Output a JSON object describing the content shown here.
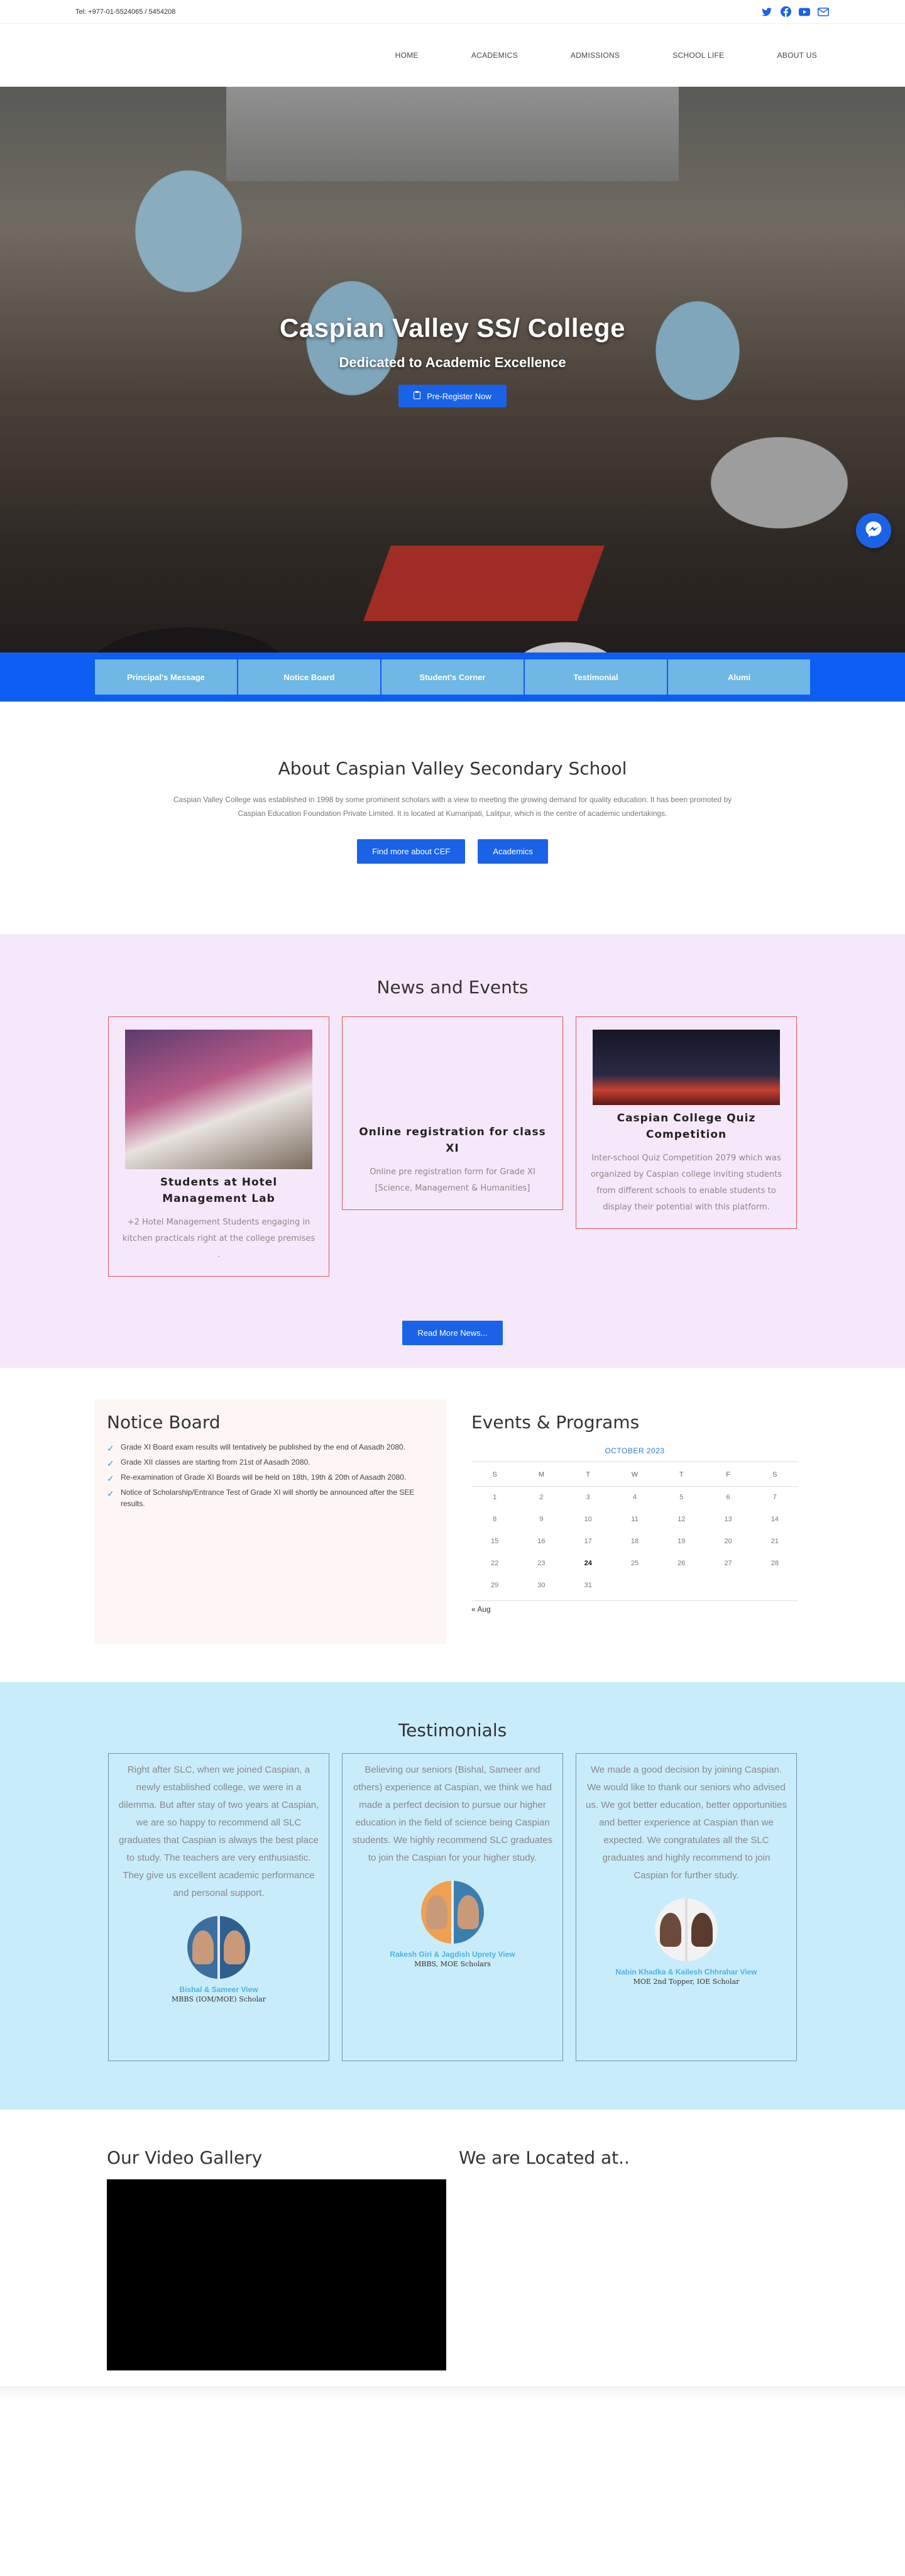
{
  "topbar": {
    "phone": "Tel: +977-01-5524065 / 5454208",
    "icons": [
      "twitter-icon",
      "facebook-icon",
      "youtube-icon",
      "email-icon"
    ],
    "icon_color": "#1a63e8"
  },
  "nav": {
    "items": [
      "HOME",
      "ACADEMICS",
      "ADMISSIONS",
      "SCHOOL LIFE",
      "ABOUT US"
    ]
  },
  "hero": {
    "title": "Caspian Valley SS/ College",
    "subtitle": "Dedicated to Academic Excellence",
    "cta": "Pre-Register Now"
  },
  "tabs": [
    "Principal's Message",
    "Notice Board",
    "Student's Corner",
    "Testimonial",
    "Alumi"
  ],
  "about": {
    "title": "About Caspian Valley Secondary School",
    "text": "Caspian Valley College was established in 1998 by some prominent scholars with a view to meeting the growing demand for quality education. It has been promoted by Caspian Education Foundation Private Limited. It is located at Kumaripati, Lalitpur, which is the centre of academic undertakings.",
    "btn1": "Find more about CEF",
    "btn2": "Academics"
  },
  "news": {
    "title": "News and Events",
    "cards": [
      {
        "title": "Students at Hotel Management Lab",
        "text": "+2 Hotel Management Students engaging in kitchen practicals right at the college premises ."
      },
      {
        "title": "Online registration for class XI",
        "text": "Online pre registration form for Grade XI [Science, Management & Humanities]"
      },
      {
        "title": "Caspian College Quiz Competition",
        "text": "Inter-school Quiz Competition 2079 which was organized by Caspian college inviting students from different schools to enable students to display their potential with this platform."
      }
    ],
    "more": "Read More News..."
  },
  "notice": {
    "title": "Notice Board",
    "items": [
      "Grade XI Board exam results will tentatively be published by the end of Aasadh 2080.",
      "Grade XII classes are starting from 21st of Aasadh 2080.",
      "Re-examination of Grade XI Boards will be held on 18th, 19th & 20th of Aasadh 2080.",
      "Notice of Scholarship/Entrance Test of Grade XI will shortly be announced after the SEE results."
    ]
  },
  "events": {
    "title": "Events & Programs",
    "month": "OCTOBER 2023",
    "days": [
      "S",
      "M",
      "T",
      "W",
      "T",
      "F",
      "S"
    ],
    "weeks": [
      [
        "1",
        "2",
        "3",
        "4",
        "5",
        "6",
        "7"
      ],
      [
        "8",
        "9",
        "10",
        "11",
        "12",
        "13",
        "14"
      ],
      [
        "15",
        "16",
        "17",
        "18",
        "19",
        "20",
        "21"
      ],
      [
        "22",
        "23",
        "24",
        "25",
        "26",
        "27",
        "28"
      ],
      [
        "29",
        "30",
        "31",
        "",
        "",
        "",
        ""
      ]
    ],
    "today": "24",
    "prev": "« Aug"
  },
  "testimonials": {
    "title": "Testimonials",
    "cards": [
      {
        "quote": "Right after SLC, when we joined Caspian, a newly established college, we were in a dilemma. But after stay of two years at Caspian, we are so happy to recommend all SLC graduates that Caspian is always the best place to study. The teachers are very enthusiastic. They give us excellent academic performance and personal support.",
        "name": "Bishal & Sameer View",
        "role": "MBBS (IOM/MOE) Scholar"
      },
      {
        "quote": "Believing our seniors (Bishal, Sameer and others) experience at Caspian, we think we had made a perfect decision to pursue our higher education in the field of science being Caspian students. We highly recommend SLC graduates to join the Caspian for your higher study.",
        "name": "Rakesh Giri & Jagdish Uprety View",
        "role": "MBBS, MOE Scholars"
      },
      {
        "quote": "We made a good decision by joining Caspian. We would like to thank our seniors who advised us. We got better education, better opportunities and better experience at Caspian than we expected. We congratulates all the SLC graduates and highly recommend to join Caspian for further study.",
        "name": "Nabin Khadka & Kailesh Chhrahar View",
        "role": "MOE 2nd Topper, IOE Scholar"
      }
    ]
  },
  "gallery": {
    "video_title": "Our Video Gallery",
    "map_title": "We are Located at.."
  },
  "colors": {
    "primary_blue": "#1a63e8",
    "tab_blue": "#6fb7e4",
    "news_bg": "#f6e8fb",
    "testimonial_bg": "#c9ecfa",
    "card_border_red": "#e05550"
  }
}
